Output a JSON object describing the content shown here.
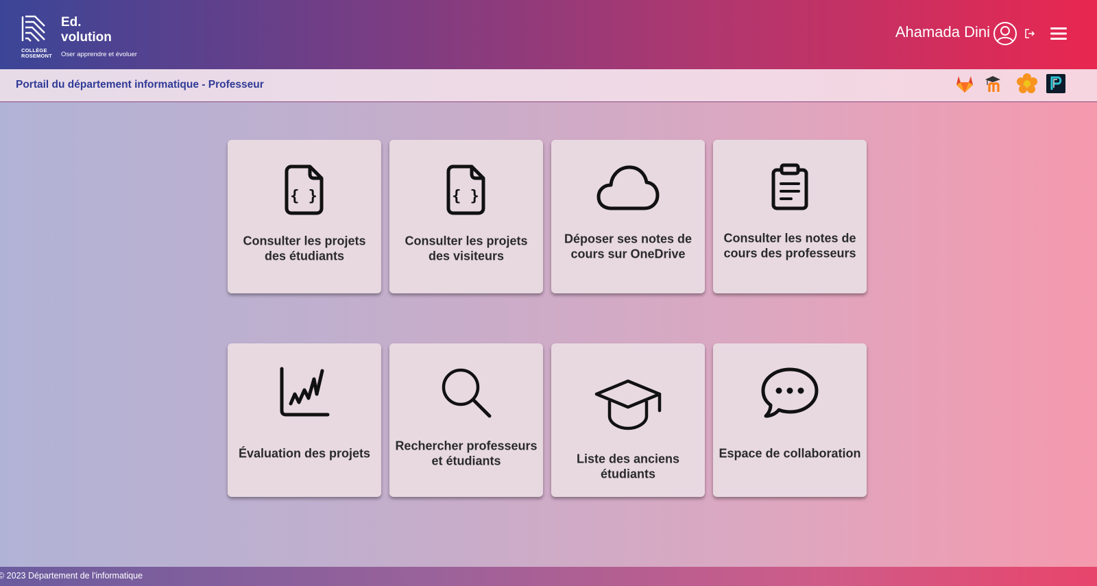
{
  "header": {
    "logo_caption": [
      "COLLÈGE",
      "ROSEMONT"
    ],
    "brand_title_line1": "Ed.",
    "brand_title_line2": "volution",
    "tagline": "Oser apprendre et évoluer",
    "user_name": "Ahamada Dini"
  },
  "subheader": {
    "portal_title": "Portail du département informatique - Professeur",
    "tools": [
      "gitlab-icon",
      "moodle-icon",
      "flower-icon",
      "p-app-icon"
    ]
  },
  "cards": [
    {
      "label": "Consulter les projets des étudiants",
      "icon": "code-file-icon"
    },
    {
      "label": "Consulter les projets des visiteurs",
      "icon": "code-file-icon"
    },
    {
      "label": "Déposer ses notes de cours sur OneDrive",
      "icon": "cloud-icon"
    },
    {
      "label": "Consulter les notes de cours des professeurs",
      "icon": "clipboard-icon"
    },
    {
      "label": "Évaluation des projets",
      "icon": "line-chart-icon"
    },
    {
      "label": "Rechercher professeurs et étudiants",
      "icon": "search-icon"
    },
    {
      "label": "Liste des anciens étudiants",
      "icon": "graduation-cap-icon"
    },
    {
      "label": "Espace de collaboration",
      "icon": "chat-bubble-icon"
    }
  ],
  "footer": {
    "copyright": "© 2023 Département de l'informatique"
  },
  "colors": {
    "header_start": "#3b4597",
    "header_end": "#e82750",
    "portal_title": "#2f3a96",
    "card_bg": "#e8d9e1"
  }
}
